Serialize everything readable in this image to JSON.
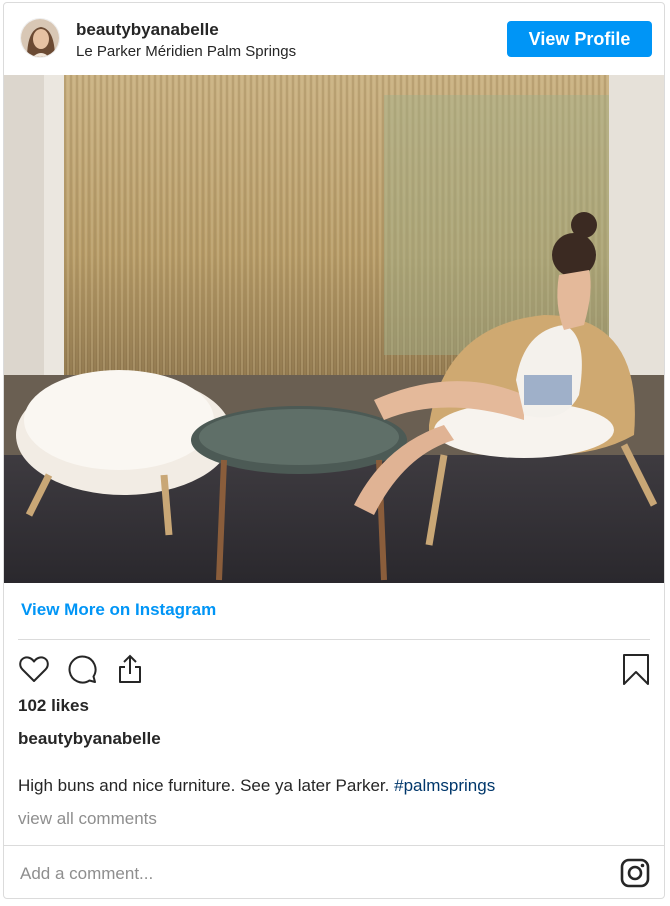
{
  "header": {
    "username": "beautybyanabelle",
    "location": "Le Parker Méridien Palm Springs",
    "view_profile_label": "View Profile"
  },
  "post": {
    "view_more_label": "View More on Instagram",
    "likes": "102 likes",
    "caption_user": "beautybyanabelle",
    "caption_text": "High buns and nice furniture. See ya later Parker. ",
    "hashtag": "#palmsprings",
    "view_comments": "view all comments"
  },
  "comment": {
    "placeholder": "Add a comment..."
  },
  "icons": [
    "heart-icon",
    "comment-icon",
    "share-icon",
    "bookmark-icon",
    "instagram-logo-icon"
  ],
  "colors": {
    "accent": "#0095f6",
    "hashtag": "#00376b",
    "muted": "#8e8e8e",
    "border": "#dbdbdb"
  }
}
